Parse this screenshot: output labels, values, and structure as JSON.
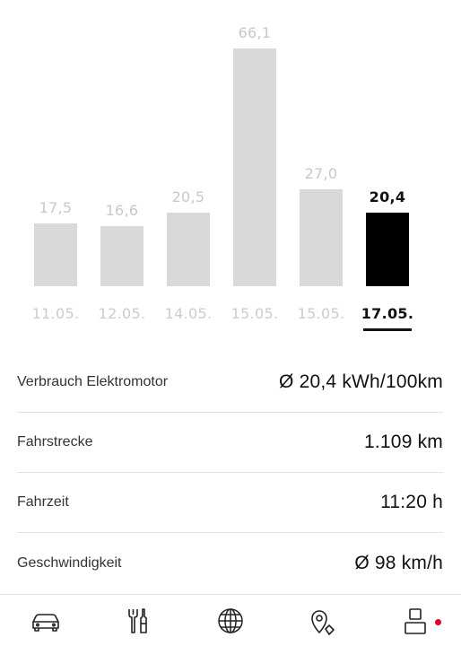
{
  "chart_data": {
    "type": "bar",
    "categories": [
      "11.05.",
      "12.05.",
      "14.05.",
      "15.05.",
      "15.05.",
      "17.05."
    ],
    "values": [
      17.5,
      16.6,
      20.5,
      66.1,
      27.0,
      20.4
    ],
    "value_labels": [
      "17,5",
      "16,6",
      "20,5",
      "66,1",
      "27,0",
      "20,4"
    ],
    "selected_index": 5,
    "title": "",
    "xlabel": "",
    "ylabel": "",
    "grid": false,
    "colors": {
      "bar": "#d9d9d9",
      "selected": "#000000"
    }
  },
  "stats": [
    {
      "label": "Verbrauch Elektromotor",
      "value": "Ø 20,4 kWh/100km"
    },
    {
      "label": "Fahrstrecke",
      "value": "1.109 km"
    },
    {
      "label": "Fahrzeit",
      "value": "11:20 h"
    },
    {
      "label": "Geschwindigkeit",
      "value": "Ø 98 km/h"
    }
  ],
  "nav": {
    "items": [
      {
        "icon": "car-icon"
      },
      {
        "icon": "tools-icon"
      },
      {
        "icon": "globe-icon"
      },
      {
        "icon": "map-pin-route-icon"
      },
      {
        "icon": "profile-icon"
      }
    ],
    "notification_color": "#e3002b"
  }
}
